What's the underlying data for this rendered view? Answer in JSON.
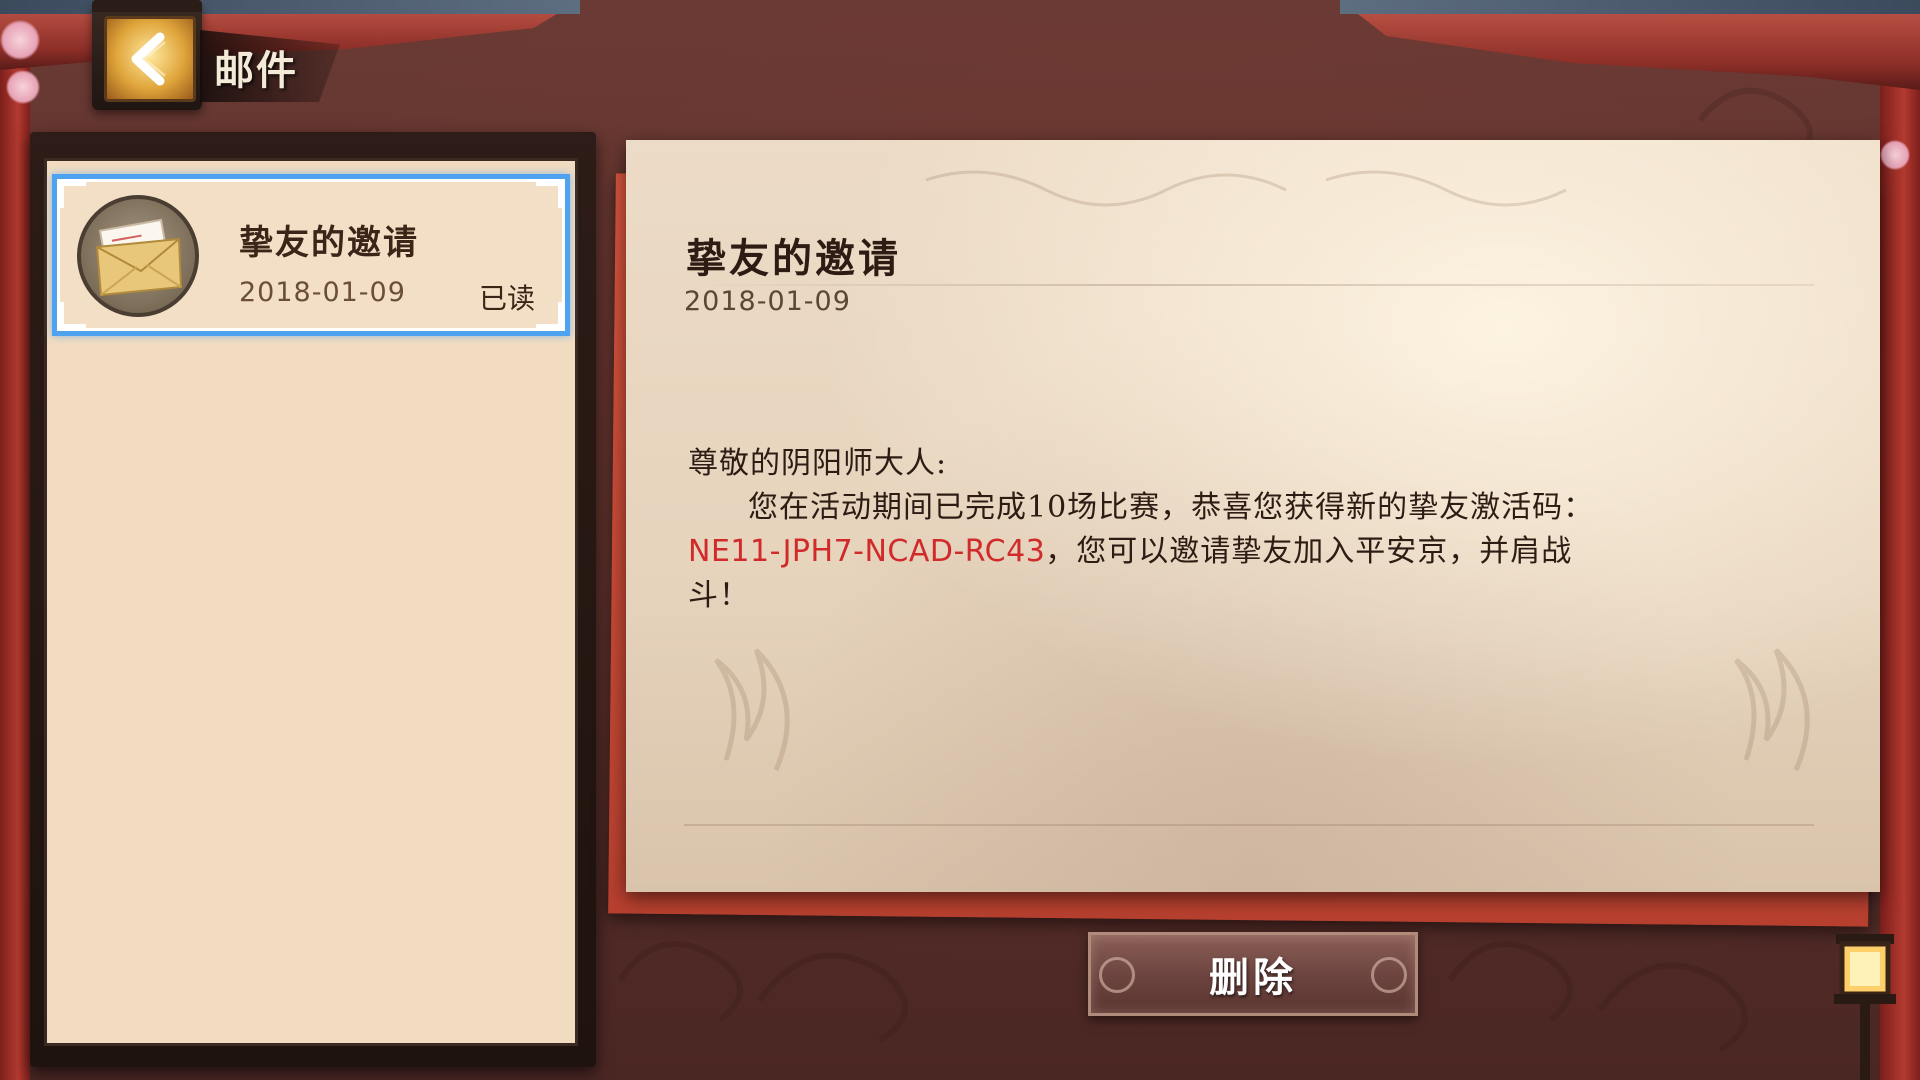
{
  "header": {
    "title": "邮件",
    "back_icon": "chevron-left-icon"
  },
  "mail_list": {
    "items": [
      {
        "title": "挚友的邀请",
        "date": "2018-01-09",
        "status": "已读",
        "icon": "envelope-icon",
        "selected": true
      }
    ]
  },
  "letter": {
    "title": "挚友的邀请",
    "date": "2018-01-09",
    "greeting": "尊敬的阴阳师大人:",
    "line1": "您在活动期间已完成10场比赛，恭喜您获得新的挚友激活码：",
    "code": "NE11-JPH7-NCAD-RC43",
    "line2_rest": "，您可以邀请挚友加入平安京，并肩战",
    "line3": "斗！"
  },
  "actions": {
    "delete_label": "删除"
  },
  "colors": {
    "selection_border": "#4ea2f0",
    "code_text": "#d12a2a",
    "paper": "#ecdbc6",
    "list_panel": "#f2dcc1"
  }
}
